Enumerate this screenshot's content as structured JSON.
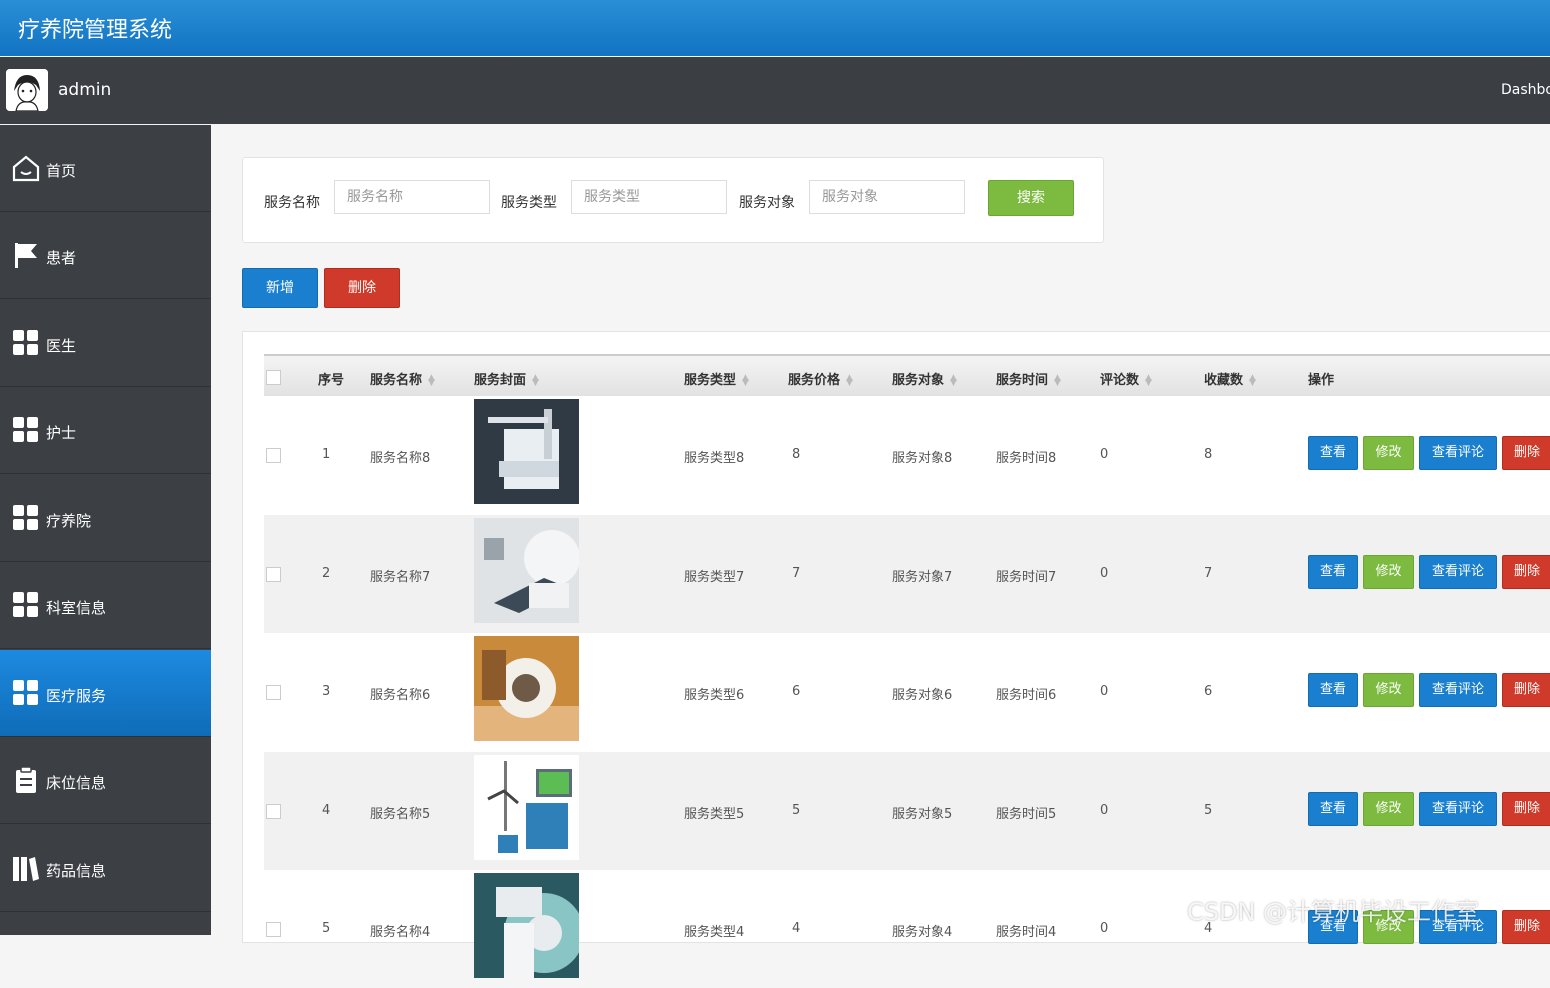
{
  "app": {
    "title": "疗养院管理系统",
    "dashboard_label": "Dashbo"
  },
  "user": {
    "name": "admin"
  },
  "sidebar": {
    "items": [
      {
        "label": "首页",
        "icon": "home-icon"
      },
      {
        "label": "患者",
        "icon": "flag-icon"
      },
      {
        "label": "医生",
        "icon": "grid-icon"
      },
      {
        "label": "护士",
        "icon": "grid-icon"
      },
      {
        "label": "疗养院",
        "icon": "grid-icon"
      },
      {
        "label": "科室信息",
        "icon": "grid-icon"
      },
      {
        "label": "医疗服务",
        "icon": "grid-icon",
        "active": true
      },
      {
        "label": "床位信息",
        "icon": "clipboard-icon"
      },
      {
        "label": "药品信息",
        "icon": "books-icon"
      }
    ]
  },
  "search": {
    "name_label": "服务名称",
    "name_placeholder": "服务名称",
    "type_label": "服务类型",
    "type_placeholder": "服务类型",
    "target_label": "服务对象",
    "target_placeholder": "服务对象",
    "button": "搜索"
  },
  "actions": {
    "add": "新增",
    "delete": "删除"
  },
  "table": {
    "headers": [
      "序号",
      "服务名称",
      "服务封面",
      "服务类型",
      "服务价格",
      "服务对象",
      "服务时间",
      "评论数",
      "收藏数",
      "操作"
    ],
    "row_buttons": {
      "view": "查看",
      "edit": "修改",
      "comments": "查看评论",
      "delete": "删除"
    },
    "rows": [
      {
        "no": "1",
        "name": "服务名称8",
        "type": "服务类型8",
        "price": "8",
        "target": "服务对象8",
        "time": "服务时间8",
        "comments": "0",
        "favorites": "8"
      },
      {
        "no": "2",
        "name": "服务名称7",
        "type": "服务类型7",
        "price": "7",
        "target": "服务对象7",
        "time": "服务时间7",
        "comments": "0",
        "favorites": "7"
      },
      {
        "no": "3",
        "name": "服务名称6",
        "type": "服务类型6",
        "price": "6",
        "target": "服务对象6",
        "time": "服务时间6",
        "comments": "0",
        "favorites": "6"
      },
      {
        "no": "4",
        "name": "服务名称5",
        "type": "服务类型5",
        "price": "5",
        "target": "服务对象5",
        "time": "服务时间5",
        "comments": "0",
        "favorites": "5"
      },
      {
        "no": "5",
        "name": "服务名称4",
        "type": "服务类型4",
        "price": "4",
        "target": "服务对象4",
        "time": "服务时间4",
        "comments": "0",
        "favorites": "4"
      }
    ]
  },
  "watermark": "CSDN @计算机毕设工作室",
  "colors": {
    "primary": "#1a7fcf",
    "success": "#7dbb40",
    "danger": "#cf3a2a",
    "sidebar": "#3c3f44"
  }
}
